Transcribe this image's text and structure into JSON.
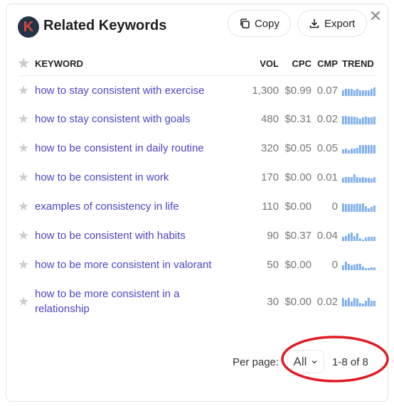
{
  "header": {
    "logo_letter": "K",
    "title": "Related Keywords",
    "copy_label": "Copy",
    "export_label": "Export",
    "icons": {
      "logo": "keywords-everywhere-logo",
      "copy": "copy-icon",
      "export": "download-icon",
      "close": "close-icon"
    }
  },
  "table": {
    "columns": [
      "KEYWORD",
      "VOL",
      "CPC",
      "CMP",
      "TREND"
    ],
    "rows": [
      {
        "keyword": "how to stay consistent with exercise",
        "vol": "1,300",
        "cpc": "$0.99",
        "cmp": "0.07",
        "trend": [
          7,
          8,
          8,
          8,
          7,
          8,
          7,
          7,
          7,
          7,
          8,
          10
        ]
      },
      {
        "keyword": "how to stay consistent with goals",
        "vol": "480",
        "cpc": "$0.31",
        "cmp": "0.02",
        "trend": [
          10,
          10,
          9,
          9,
          9,
          8,
          7,
          8,
          9,
          8,
          8,
          9
        ]
      },
      {
        "keyword": "how to be consistent in daily routine",
        "vol": "320",
        "cpc": "$0.05",
        "cmp": "0.05",
        "trend": [
          5,
          6,
          4,
          6,
          6,
          7,
          10,
          10,
          10,
          10,
          10,
          10
        ]
      },
      {
        "keyword": "how to be consistent in work",
        "vol": "170",
        "cpc": "$0.00",
        "cmp": "0.01",
        "trend": [
          6,
          7,
          7,
          7,
          10,
          7,
          6,
          7,
          6,
          6,
          5,
          7
        ]
      },
      {
        "keyword": "examples of consistency in life",
        "vol": "110",
        "cpc": "$0.00",
        "cmp": "0",
        "trend": [
          9,
          8,
          8,
          8,
          8,
          9,
          8,
          9,
          6,
          4,
          5,
          7
        ]
      },
      {
        "keyword": "how to be consistent with habits",
        "vol": "90",
        "cpc": "$0.37",
        "cmp": "0.04",
        "trend": [
          5,
          6,
          8,
          10,
          6,
          9,
          3,
          2,
          4,
          5,
          5,
          5
        ]
      },
      {
        "keyword": "how to be more consistent in valorant",
        "vol": "50",
        "cpc": "$0.00",
        "cmp": "0",
        "trend": [
          5,
          9,
          7,
          5,
          6,
          7,
          7,
          4,
          2,
          2,
          3,
          3
        ]
      },
      {
        "keyword": "how to be more consistent in a relationship",
        "vol": "30",
        "cpc": "$0.00",
        "cmp": "0.02",
        "trend": [
          9,
          7,
          9,
          5,
          9,
          8,
          4,
          3,
          6,
          9,
          6,
          6
        ]
      }
    ]
  },
  "footer": {
    "per_page_label": "Per page:",
    "per_page_value": "All",
    "range_text": "1-8 of 8"
  },
  "colors": {
    "keyword_link": "#4c45c4",
    "trend_bar": "#8db9f0",
    "annotation": "#e01b24",
    "logo_bg": "#243447",
    "logo_letter": "#d9453a"
  }
}
